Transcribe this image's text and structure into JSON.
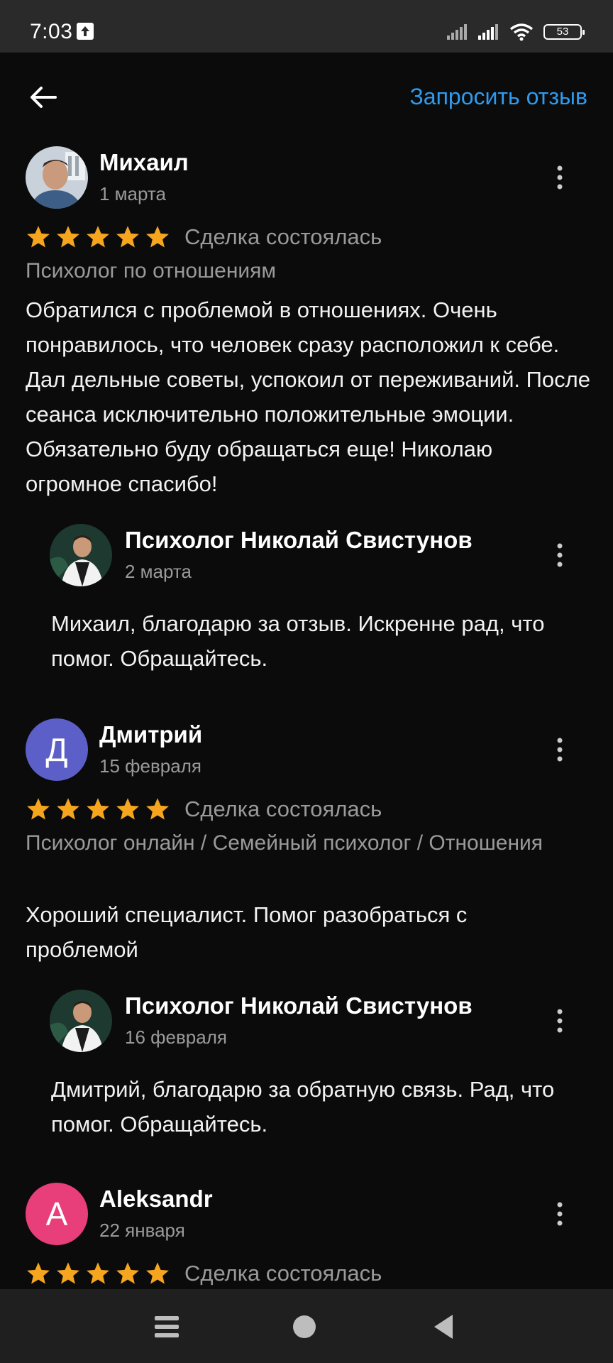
{
  "status_bar": {
    "time": "7:03",
    "battery": "53"
  },
  "header": {
    "back_icon": "arrow-left-icon",
    "request_label": "Запросить отзыв"
  },
  "colors": {
    "accent": "#2e9bf0",
    "star": "#f6a51f",
    "avatar_d": "#5b5fc7",
    "avatar_a": "#e83e7a"
  },
  "reviews": [
    {
      "name": "Михаил",
      "date": "1 марта",
      "rating": 5,
      "deal": "Сделка состоялась",
      "category": "Психолог по отношениям",
      "text": "Обратился с проблемой в отношениях. Очень понравилось, что человек сразу расположил к себе. Дал дельные советы, успокоил от переживаний. После сеанса исключительно положительные эмоции. Обязательно буду обращаться еще! Николаю огромное спасибо!",
      "reply": {
        "name": "Психолог Николай Свистунов",
        "date": "2 марта",
        "text": "Михаил, благодарю за отзыв. Искренне рад, что помог. Обращайтесь."
      }
    },
    {
      "name": "Дмитрий",
      "avatar_letter": "Д",
      "date": "15 февраля",
      "rating": 5,
      "deal": "Сделка состоялась",
      "category": "Психолог онлайн / Семейный психолог / Отношения",
      "text": "Хороший специалист. Помог разобраться с проблемой",
      "reply": {
        "name": "Психолог Николай Свистунов",
        "date": "16 февраля",
        "text": "Дмитрий, благодарю за обратную связь. Рад, что помог. Обращайтесь."
      }
    },
    {
      "name": "Aleksandr",
      "avatar_letter": "A",
      "date": "22 января",
      "rating": 5,
      "deal": "Сделка состоялась"
    }
  ],
  "nav": {
    "menu_icon": "menu-icon",
    "home_icon": "home-circle-icon",
    "back_icon": "back-triangle-icon"
  }
}
